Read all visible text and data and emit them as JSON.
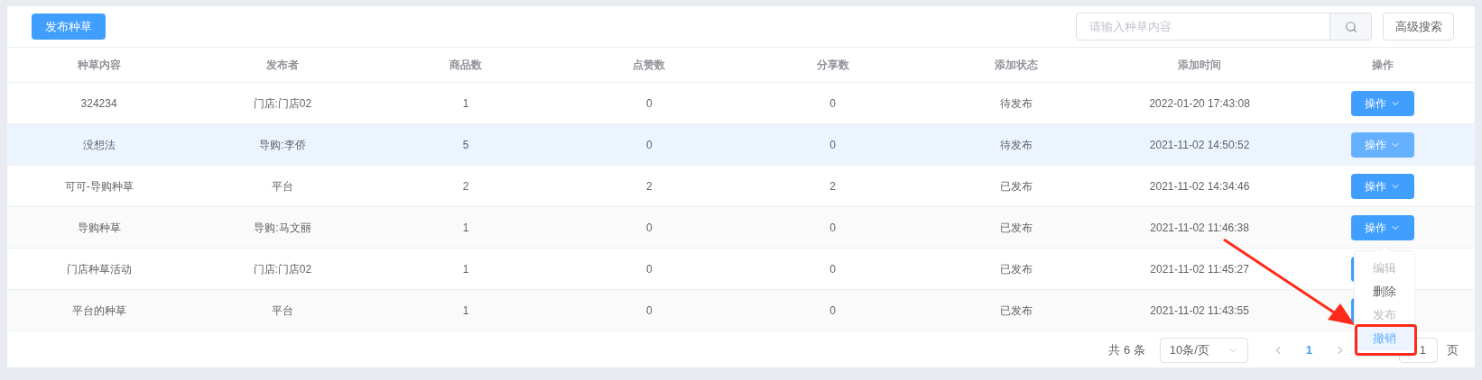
{
  "toolbar": {
    "publish_button": "发布种草",
    "search": {
      "placeholder": "请输入种草内容"
    },
    "advanced_search_button": "高级搜索"
  },
  "table": {
    "columns": [
      "种草内容",
      "发布者",
      "商品数",
      "点赞数",
      "分享数",
      "添加状态",
      "添加时间",
      "操作"
    ],
    "rows": [
      {
        "cells": [
          "324234",
          "门店:门店02",
          "1",
          "0",
          "0",
          "待发布",
          "2022-01-20 17:43:08"
        ],
        "action": "操作",
        "hovered": false
      },
      {
        "cells": [
          "没想法",
          "导购:李侨",
          "5",
          "0",
          "0",
          "待发布",
          "2021-11-02 14:50:52"
        ],
        "action": "操作",
        "hovered": true
      },
      {
        "cells": [
          "可可-导购种草",
          "平台",
          "2",
          "2",
          "2",
          "已发布",
          "2021-11-02 14:34:46"
        ],
        "action": "操作",
        "hovered": false
      },
      {
        "cells": [
          "导购种草",
          "导购:马文丽",
          "1",
          "0",
          "0",
          "已发布",
          "2021-11-02 11:46:38"
        ],
        "action": "操作",
        "hovered": false
      },
      {
        "cells": [
          "门店种草活动",
          "门店:门店02",
          "1",
          "0",
          "0",
          "已发布",
          "2021-11-02 11:45:27"
        ],
        "hovered": false
      },
      {
        "cells": [
          "平台的种草",
          "平台",
          "1",
          "0",
          "0",
          "已发布",
          "2021-11-02 11:43:55"
        ],
        "hovered": false
      }
    ]
  },
  "dropdown_menu": {
    "items": [
      {
        "label": "编辑",
        "disabled": true,
        "hovered": false
      },
      {
        "label": "删除",
        "disabled": false,
        "hovered": false
      },
      {
        "label": "发布",
        "disabled": true,
        "hovered": false
      },
      {
        "label": "撤销",
        "disabled": false,
        "hovered": true
      }
    ]
  },
  "pagination": {
    "total": "共 6 条",
    "page_size": "10条/页",
    "current_page": "1",
    "jump_value": "1",
    "jump_suffix": "页"
  }
}
